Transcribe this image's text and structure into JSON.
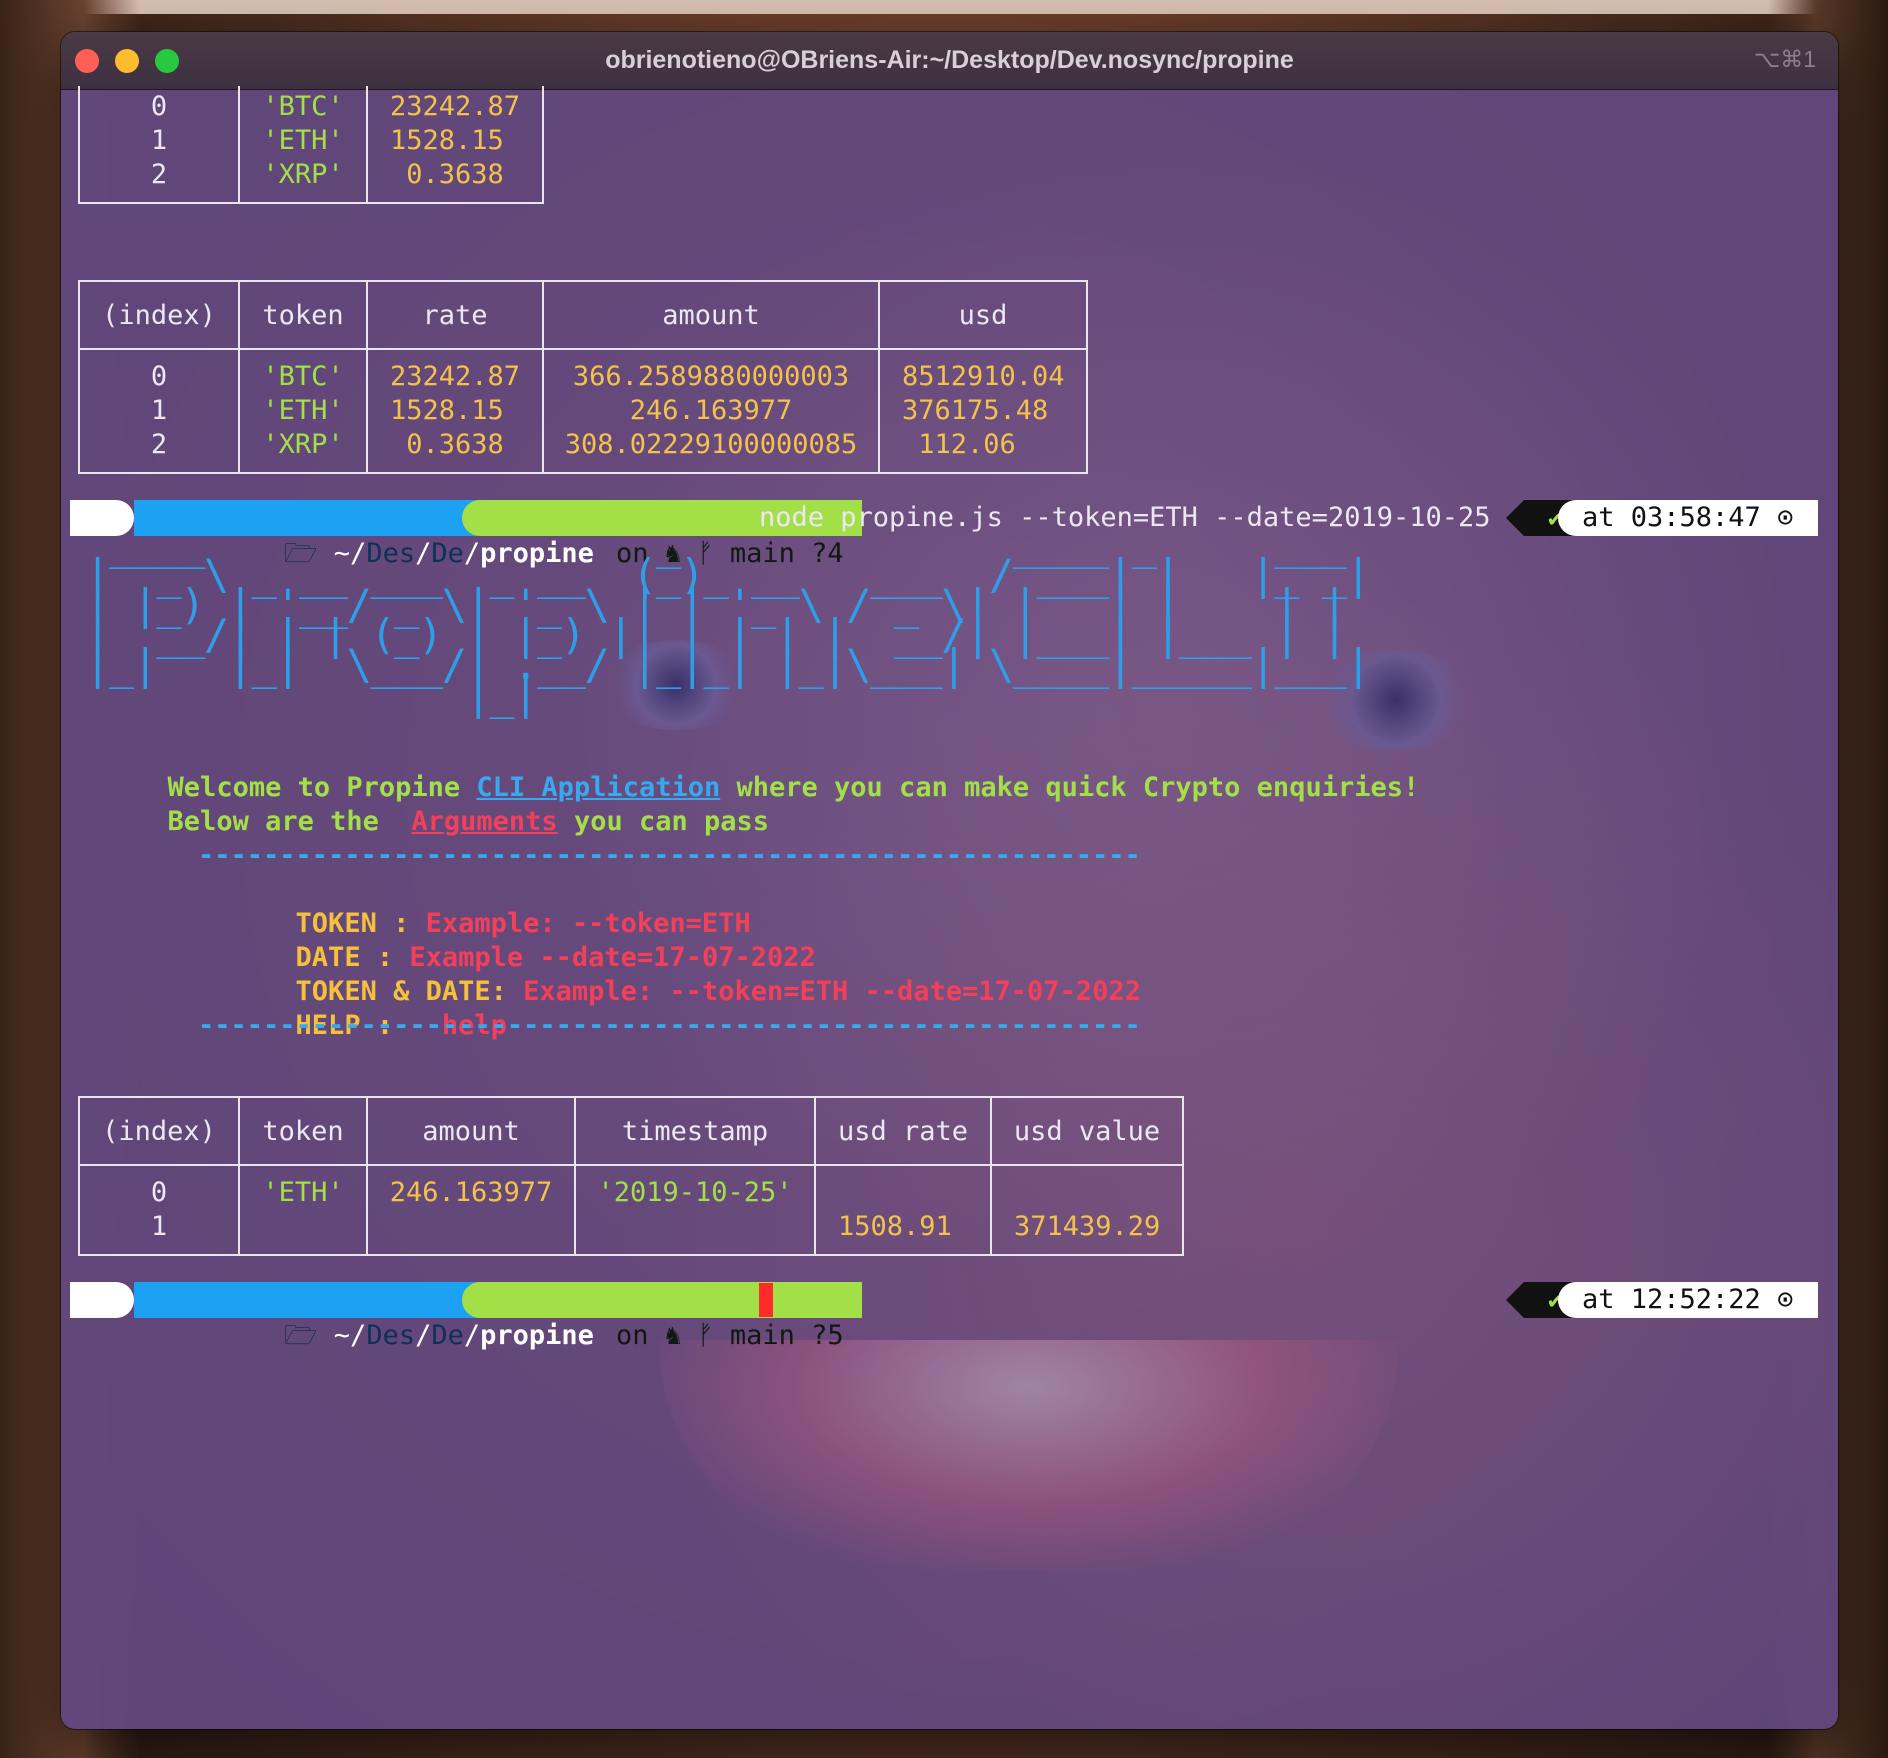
{
  "window": {
    "title": "obrienotieno@OBriens-Air:~/Desktop/Dev.nosync/propine",
    "shortcut": "⌥⌘1"
  },
  "table_partial": {
    "rows": [
      {
        "index": "0",
        "token": "'BTC'",
        "rate": "23242.87"
      },
      {
        "index": "1",
        "token": "'ETH'",
        "rate": "1528.15"
      },
      {
        "index": "2",
        "token": "'XRP'",
        "rate": " 0.3638"
      }
    ]
  },
  "table_portfolio": {
    "headers": [
      "(index)",
      "token",
      "rate",
      "amount",
      "usd"
    ],
    "rows": [
      {
        "index": "0",
        "token": "'BTC'",
        "rate": "23242.87",
        "amount": "366.2589880000003",
        "usd": "8512910.04"
      },
      {
        "index": "1",
        "token": "'ETH'",
        "rate": "1528.15",
        "amount": "246.163977",
        "usd": "376175.48"
      },
      {
        "index": "2",
        "token": "'XRP'",
        "rate": " 0.3638",
        "amount": "308.02229100000085",
        "usd": " 112.06"
      }
    ]
  },
  "prompt1": {
    "apple": "",
    "folder_icon": "🗁",
    "path_prefix": "~/",
    "path_mid1": "Des",
    "path_sep": "/",
    "path_mid2": "De",
    "path_sep2": "/",
    "path_last": "propine",
    "git_on": "on",
    "git_icon": "♞",
    "branch_icon": "ᚠ",
    "branch": "main ?4",
    "command": "node propine.js --token=ETH --date=2019-10-25",
    "check": "✔",
    "time": "at 03:58:47 ⊙"
  },
  "banner": {
    "ascii": " ____                   _              ____ _     ___ \n|  _ \\ _ __ ___  _ __  (_)_ __   ___  / ___| |   |_ _|\n| |_) | '__/ _ \\| '_ \\ | | '_ \\ / _ \\| |   | |    | | \n|  __/| | | (_) | |_) || | | | |  __/| |___| |___ | | \n|_|   |_|  \\___/| .__/ |_|_| |_|\\___| \\____|_____|___|\n                |_|                                   ",
    "welcome_a": "Welcome to Propine ",
    "welcome_link": "CLI Application",
    "welcome_b": " where you can make quick Crypto enquiries!",
    "below_a": "Below are the  ",
    "below_link": "Arguments",
    "below_b": " you can pass",
    "divider": "----------------------------------------------------------",
    "args": [
      {
        "key": "TOKEN : ",
        "value": "Example: --token=ETH"
      },
      {
        "key": "DATE : ",
        "value": "Example --date=17-07-2022"
      },
      {
        "key": "TOKEN & DATE: ",
        "value": "Example: --token=ETH --date=17-07-2022"
      },
      {
        "key": "HELP : ",
        "value": "--help"
      }
    ]
  },
  "table_result": {
    "headers": [
      "(index)",
      "token",
      "amount",
      "timestamp",
      "usd rate",
      "usd value"
    ],
    "rows": [
      {
        "index": "0",
        "token": "'ETH'",
        "amount": "246.163977",
        "timestamp": "'2019-10-25'",
        "usd_rate": "",
        "usd_value": ""
      },
      {
        "index": "1",
        "token": "",
        "amount": "",
        "timestamp": "",
        "usd_rate": "1508.91",
        "usd_value": "371439.29"
      }
    ]
  },
  "prompt2": {
    "branch": "main ?5",
    "time": "at 12:52:22 ⊙"
  },
  "colors": {
    "green": "#a3e048",
    "yellow": "#f3c24a",
    "blue": "#38a9f0",
    "red": "#f2405a",
    "terminal_bg": "#62487f"
  }
}
